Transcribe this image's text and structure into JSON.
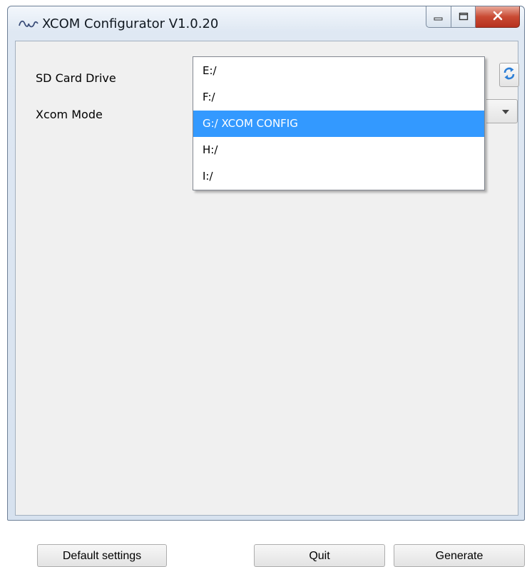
{
  "window": {
    "title": "XCOM Configurator V1.0.20",
    "app_icon": "waveform-logo-icon",
    "caption_buttons": [
      "minimize-icon",
      "maximize-icon",
      "close-icon"
    ]
  },
  "form": {
    "sd_card_label": "SD Card Drive",
    "xcom_mode_label": "Xcom Mode",
    "refresh_icon": "refresh-icon"
  },
  "sd_card_dropdown": {
    "selected": "G:/ XCOM CONFIG",
    "options": [
      "E:/",
      "F:/",
      "G:/ XCOM CONFIG",
      "H:/",
      "I:/"
    ]
  },
  "buttons": {
    "default_settings": "Default settings",
    "quit": "Quit",
    "generate": "Generate"
  },
  "colors": {
    "selection": "#3399ff",
    "close_button": "#c94a33",
    "refresh_icon": "#2d7fd6"
  }
}
